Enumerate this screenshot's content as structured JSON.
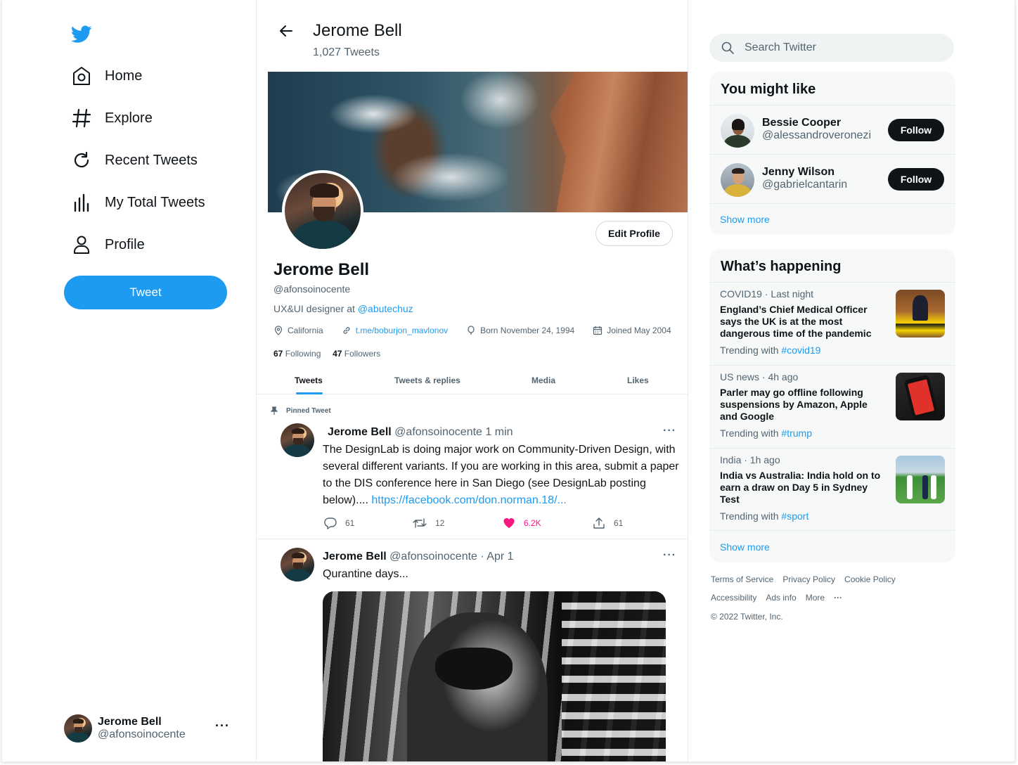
{
  "sidebar": {
    "logo": "twitter-bird-icon",
    "nav": [
      {
        "label": "Home",
        "icon": "home-icon"
      },
      {
        "label": "Explore",
        "icon": "hashtag-icon"
      },
      {
        "label": "Recent Tweets",
        "icon": "refresh-icon"
      },
      {
        "label": "My Total Tweets",
        "icon": "bar-chart-icon"
      },
      {
        "label": "Profile",
        "icon": "user-icon"
      }
    ],
    "tweet_button": "Tweet",
    "account": {
      "name": "Jerome Bell",
      "handle": "@afonsoinocente",
      "more": "···"
    }
  },
  "profile": {
    "header_name": "Jerome Bell",
    "tweet_count": "1,027 Tweets",
    "edit_button": "Edit Profile",
    "name": "Jerome Bell",
    "handle": "@afonsoinocente",
    "bio_text": "UX&UI designer at ",
    "bio_link": "@abutechuz",
    "location": "California",
    "website": "t.me/boburjon_mavlonov",
    "born": "Born November 24, 1994",
    "joined": "Joined May 2004",
    "following_count": "67",
    "following_label": "Following",
    "followers_count": "47",
    "followers_label": "Followers",
    "tabs": [
      "Tweets",
      "Tweets & replies",
      "Media",
      "Likes"
    ],
    "active_tab": "Tweets"
  },
  "tweets": [
    {
      "pinned_label": "Pinned Tweet",
      "name": "Jerome Bell",
      "handle": "@afonsoinocente",
      "time": "1 min",
      "text": "The DesignLab is doing major work on Community-Driven Design, with several different variants. If you are working in this area, submit a paper to the DIS conference here in San Diego (see DesignLab posting below).... ",
      "link": "https://facebook.com/don.norman.18/...",
      "replies": "61",
      "retweets": "12",
      "likes": "6.2K",
      "shares": "61",
      "more": "···"
    },
    {
      "name": "Jerome Bell",
      "handle": "@afonsoinocente",
      "time": "· Apr 1",
      "text": "Qurantine days...",
      "more": "···"
    }
  ],
  "right": {
    "search_placeholder": "Search Twitter",
    "you_might_like": {
      "title": "You might like",
      "people": [
        {
          "name": "Bessie Cooper",
          "handle": "@alessandroveronezi",
          "button": "Follow"
        },
        {
          "name": "Jenny Wilson",
          "handle": "@gabrielcantarin",
          "button": "Follow"
        }
      ],
      "show_more": "Show more"
    },
    "whats_happening": {
      "title": "What’s happening",
      "trends": [
        {
          "meta": "COVID19 · Last night",
          "title": "England’s Chief Medical Officer says the UK is at the most dangerous time of the pandemic",
          "trending_label": "Trending with ",
          "tag": "#covid19"
        },
        {
          "meta": "US news · 4h ago",
          "title": "Parler may go offline following suspensions by Amazon, Apple and Google",
          "trending_label": "Trending with ",
          "tag": "#trump"
        },
        {
          "meta": "India · 1h ago",
          "title": "India vs Australia: India hold on to earn a draw on Day 5 in Sydney Test",
          "trending_label": "Trending with ",
          "tag": "#sport"
        }
      ],
      "show_more": "Show more"
    },
    "footer": {
      "links_row1": [
        "Terms of Service",
        "Privacy Policy",
        "Cookie Policy"
      ],
      "links_row2": [
        "Accessibility",
        "Ads info",
        "More",
        "···"
      ],
      "copyright": "© 2022 Twitter, Inc."
    }
  },
  "colors": {
    "accent": "#1d9bf0",
    "like": "#f91880",
    "text": "#0f1419",
    "muted": "#536471"
  }
}
